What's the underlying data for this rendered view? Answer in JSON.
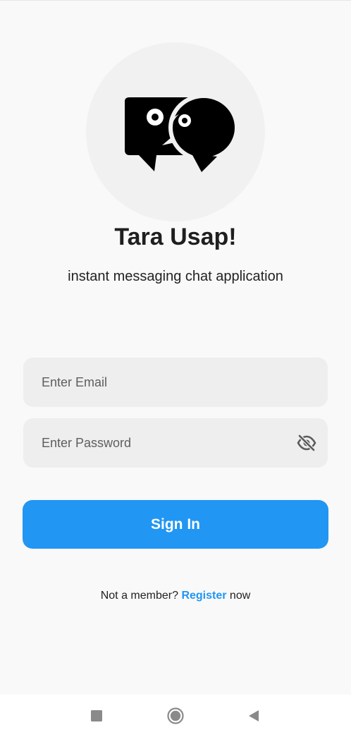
{
  "app": {
    "title": "Tara Usap!",
    "subtitle": "instant messaging chat application",
    "logo_icon": "chat-bubbles-logo-icon"
  },
  "form": {
    "email_placeholder": "Enter Email",
    "email_value": "",
    "password_placeholder": "Enter Password",
    "password_value": "",
    "visibility_icon": "eye-off-icon",
    "submit_label": "Sign In"
  },
  "register": {
    "prefix": "Not a member?",
    "link_label": "Register",
    "suffix": "now"
  },
  "navigation_bar": {
    "buttons": [
      "recent-apps-icon",
      "home-icon",
      "back-icon"
    ]
  },
  "colors": {
    "background": "#f9f9f9",
    "accent": "#2196f3",
    "field_background": "#eeeeee",
    "logo_circle": "#f1f1f1",
    "title_text": "#1f1f1f"
  }
}
